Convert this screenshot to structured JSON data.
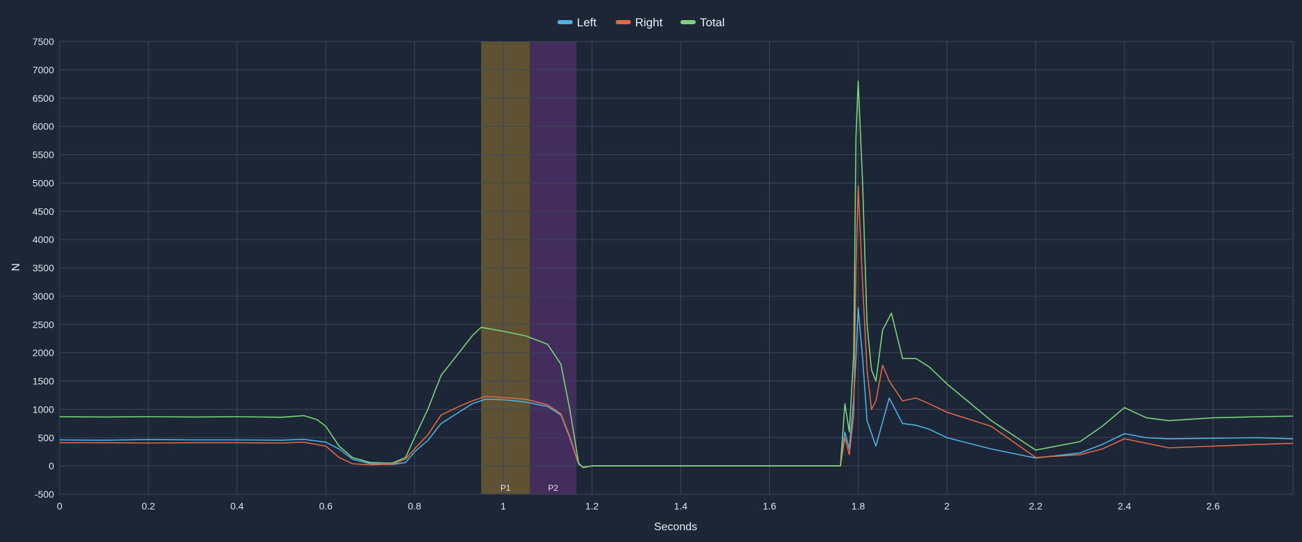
{
  "chart_data": {
    "type": "line",
    "xlabel": "Seconds",
    "ylabel": "N",
    "xlim": [
      0,
      2.78
    ],
    "ylim": [
      -500,
      7500
    ],
    "x_ticks": [
      0,
      0.2,
      0.4,
      0.6,
      0.8,
      1,
      1.2,
      1.4,
      1.6,
      1.8,
      2,
      2.2,
      2.4,
      2.6
    ],
    "x_tick_labels": [
      "0",
      "0.2",
      "0.4",
      "0.6",
      "0.8",
      "1",
      "1.2",
      "1.4",
      "1.6",
      "1.8",
      "2",
      "2.2",
      "2.4",
      "2.6"
    ],
    "y_ticks": [
      -500,
      0,
      500,
      1000,
      1500,
      2000,
      2500,
      3000,
      3500,
      4000,
      4500,
      5000,
      5500,
      6000,
      6500,
      7000,
      7500
    ],
    "y_tick_labels": [
      "-500",
      "0",
      "500",
      "1000",
      "1500",
      "2000",
      "2500",
      "3000",
      "3500",
      "4000",
      "4500",
      "5000",
      "5500",
      "6000",
      "6500",
      "7000",
      "7500"
    ],
    "grid": true,
    "legend_position": "top-center",
    "bands": [
      {
        "label": "P1",
        "x_start": 0.95,
        "x_end": 1.06,
        "color": "#6b5a33"
      },
      {
        "label": "P2",
        "x_start": 1.06,
        "x_end": 1.165,
        "color": "#4a2f63"
      }
    ],
    "series": [
      {
        "name": "Left",
        "color": "#4fb2e3",
        "points": [
          [
            0,
            460
          ],
          [
            0.1,
            455
          ],
          [
            0.2,
            465
          ],
          [
            0.3,
            460
          ],
          [
            0.4,
            460
          ],
          [
            0.5,
            455
          ],
          [
            0.55,
            470
          ],
          [
            0.6,
            420
          ],
          [
            0.63,
            300
          ],
          [
            0.66,
            120
          ],
          [
            0.7,
            40
          ],
          [
            0.75,
            25
          ],
          [
            0.78,
            60
          ],
          [
            0.8,
            250
          ],
          [
            0.83,
            450
          ],
          [
            0.86,
            750
          ],
          [
            0.9,
            950
          ],
          [
            0.93,
            1100
          ],
          [
            0.96,
            1180
          ],
          [
            1.0,
            1170
          ],
          [
            1.05,
            1130
          ],
          [
            1.1,
            1050
          ],
          [
            1.13,
            900
          ],
          [
            1.15,
            500
          ],
          [
            1.17,
            30
          ],
          [
            1.18,
            -20
          ],
          [
            1.2,
            0
          ],
          [
            1.4,
            0
          ],
          [
            1.6,
            0
          ],
          [
            1.76,
            0
          ],
          [
            1.77,
            600
          ],
          [
            1.78,
            300
          ],
          [
            1.79,
            1200
          ],
          [
            1.795,
            1900
          ],
          [
            1.8,
            2800
          ],
          [
            1.81,
            1900
          ],
          [
            1.82,
            800
          ],
          [
            1.84,
            350
          ],
          [
            1.87,
            1200
          ],
          [
            1.9,
            750
          ],
          [
            1.93,
            720
          ],
          [
            1.96,
            650
          ],
          [
            2.0,
            500
          ],
          [
            2.1,
            300
          ],
          [
            2.2,
            140
          ],
          [
            2.3,
            230
          ],
          [
            2.35,
            380
          ],
          [
            2.4,
            570
          ],
          [
            2.45,
            500
          ],
          [
            2.5,
            480
          ],
          [
            2.6,
            490
          ],
          [
            2.7,
            500
          ],
          [
            2.78,
            480
          ]
        ]
      },
      {
        "name": "Right",
        "color": "#e06a45",
        "points": [
          [
            0,
            410
          ],
          [
            0.1,
            410
          ],
          [
            0.2,
            405
          ],
          [
            0.3,
            410
          ],
          [
            0.4,
            410
          ],
          [
            0.5,
            405
          ],
          [
            0.55,
            420
          ],
          [
            0.6,
            350
          ],
          [
            0.63,
            150
          ],
          [
            0.66,
            40
          ],
          [
            0.7,
            20
          ],
          [
            0.75,
            30
          ],
          [
            0.78,
            120
          ],
          [
            0.8,
            300
          ],
          [
            0.83,
            550
          ],
          [
            0.86,
            900
          ],
          [
            0.9,
            1050
          ],
          [
            0.93,
            1150
          ],
          [
            0.96,
            1230
          ],
          [
            1.0,
            1210
          ],
          [
            1.05,
            1180
          ],
          [
            1.1,
            1080
          ],
          [
            1.13,
            920
          ],
          [
            1.15,
            520
          ],
          [
            1.17,
            40
          ],
          [
            1.18,
            -20
          ],
          [
            1.2,
            0
          ],
          [
            1.4,
            0
          ],
          [
            1.6,
            0
          ],
          [
            1.76,
            0
          ],
          [
            1.77,
            500
          ],
          [
            1.78,
            200
          ],
          [
            1.79,
            900
          ],
          [
            1.795,
            3500
          ],
          [
            1.8,
            4950
          ],
          [
            1.81,
            3200
          ],
          [
            1.82,
            1700
          ],
          [
            1.83,
            1000
          ],
          [
            1.84,
            1150
          ],
          [
            1.855,
            1780
          ],
          [
            1.87,
            1500
          ],
          [
            1.9,
            1150
          ],
          [
            1.93,
            1200
          ],
          [
            1.96,
            1100
          ],
          [
            2.0,
            950
          ],
          [
            2.1,
            700
          ],
          [
            2.2,
            150
          ],
          [
            2.3,
            200
          ],
          [
            2.35,
            300
          ],
          [
            2.4,
            480
          ],
          [
            2.45,
            400
          ],
          [
            2.5,
            320
          ],
          [
            2.6,
            350
          ],
          [
            2.7,
            380
          ],
          [
            2.78,
            400
          ]
        ]
      },
      {
        "name": "Total",
        "color": "#7bd67a",
        "points": [
          [
            0,
            870
          ],
          [
            0.1,
            865
          ],
          [
            0.2,
            870
          ],
          [
            0.3,
            865
          ],
          [
            0.4,
            870
          ],
          [
            0.5,
            860
          ],
          [
            0.55,
            890
          ],
          [
            0.58,
            820
          ],
          [
            0.6,
            700
          ],
          [
            0.63,
            350
          ],
          [
            0.66,
            150
          ],
          [
            0.7,
            60
          ],
          [
            0.75,
            50
          ],
          [
            0.78,
            150
          ],
          [
            0.8,
            500
          ],
          [
            0.83,
            1000
          ],
          [
            0.86,
            1600
          ],
          [
            0.9,
            2000
          ],
          [
            0.93,
            2300
          ],
          [
            0.95,
            2450
          ],
          [
            1.0,
            2380
          ],
          [
            1.05,
            2300
          ],
          [
            1.1,
            2150
          ],
          [
            1.13,
            1800
          ],
          [
            1.15,
            1000
          ],
          [
            1.17,
            50
          ],
          [
            1.18,
            -30
          ],
          [
            1.2,
            0
          ],
          [
            1.4,
            0
          ],
          [
            1.6,
            0
          ],
          [
            1.76,
            0
          ],
          [
            1.77,
            1100
          ],
          [
            1.78,
            600
          ],
          [
            1.785,
            1300
          ],
          [
            1.79,
            2000
          ],
          [
            1.795,
            5800
          ],
          [
            1.8,
            6800
          ],
          [
            1.81,
            5000
          ],
          [
            1.82,
            2500
          ],
          [
            1.83,
            1700
          ],
          [
            1.84,
            1500
          ],
          [
            1.855,
            2400
          ],
          [
            1.875,
            2700
          ],
          [
            1.9,
            1900
          ],
          [
            1.93,
            1900
          ],
          [
            1.96,
            1750
          ],
          [
            2.0,
            1450
          ],
          [
            2.1,
            800
          ],
          [
            2.2,
            280
          ],
          [
            2.3,
            430
          ],
          [
            2.35,
            700
          ],
          [
            2.4,
            1030
          ],
          [
            2.45,
            850
          ],
          [
            2.5,
            800
          ],
          [
            2.6,
            850
          ],
          [
            2.7,
            870
          ],
          [
            2.78,
            880
          ]
        ]
      }
    ]
  }
}
